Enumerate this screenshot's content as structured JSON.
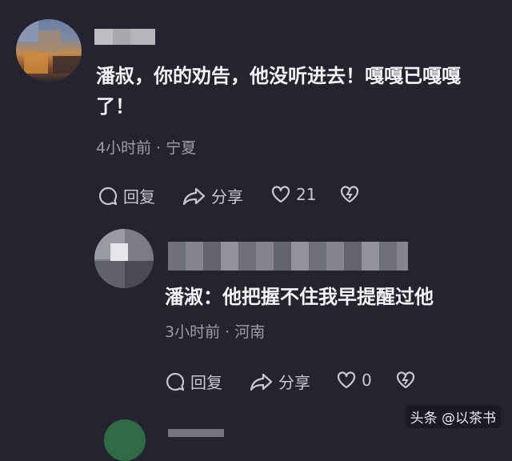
{
  "comment1": {
    "text": "潘叔，你的劝告，他没听进去！嘎嘎已嘎嘎了！",
    "meta": "4小时前 · 宁夏",
    "reply_label": "回复",
    "share_label": "分享",
    "likes": "21"
  },
  "comment2": {
    "text": "潘淑：他把握不住我早提醒过他",
    "meta": "3小时前 · 河南",
    "reply_label": "回复",
    "share_label": "分享",
    "likes": "0"
  },
  "watermark": "头条 @以茶书",
  "colors": {
    "background": "#24232f",
    "text": "#f3f3f5",
    "meta": "#9c9cab"
  }
}
